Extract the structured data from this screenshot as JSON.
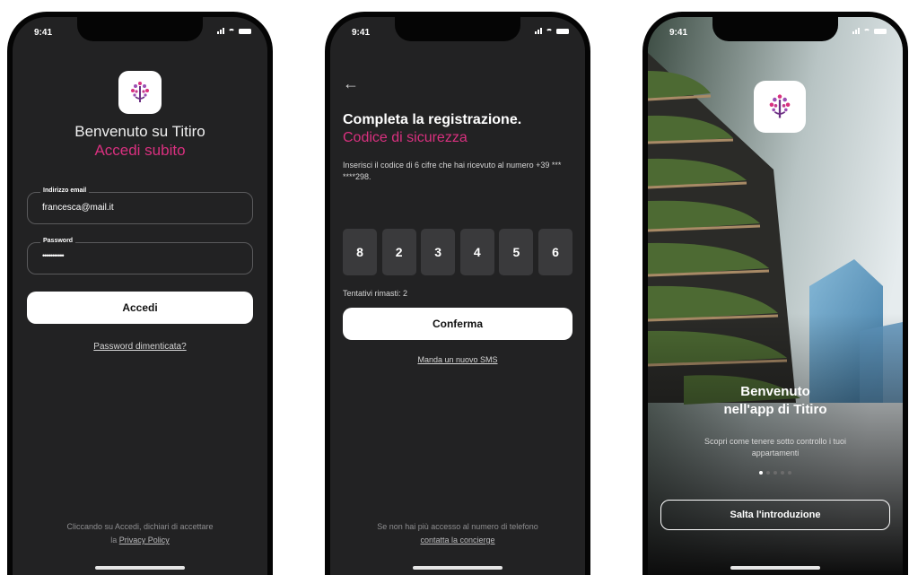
{
  "status": {
    "time": "9:41"
  },
  "login": {
    "title": "Benvenuto su Titiro",
    "subtitle": "Accedi subito",
    "email_label": "Indirizzo email",
    "email_value": "francesca@mail.it",
    "password_label": "Password",
    "password_value": "•••••••••••",
    "submit_label": "Accedi",
    "forgot_label": "Password dimenticata?",
    "footer_line1": "Cliccando su Accedi, dichiari di accettare",
    "footer_prefix": "la",
    "footer_link": "Privacy Policy"
  },
  "verify": {
    "back_glyph": "←",
    "title": "Completa la registrazione.",
    "subtitle": "Codice di sicurezza",
    "description": "Inserisci il codice di 6 cifre che hai ricevuto al numero +39 *** ****298.",
    "digits": [
      "8",
      "2",
      "3",
      "4",
      "5",
      "6"
    ],
    "attempts": "Tentativi rimasti: 2",
    "confirm_label": "Conferma",
    "resend_label": "Manda un nuovo SMS",
    "footer_line1": "Se non hai più accesso al numero di telefono",
    "footer_link": "contatta la concierge"
  },
  "intro": {
    "title_line1": "Benvenuto",
    "title_line2": "nell'app di Titiro",
    "description": "Scopri come tenere sotto controllo i tuoi appartamenti",
    "page_total": 5,
    "page_active": 1,
    "skip_label": "Salta l'introduzione"
  },
  "colors": {
    "accent": "#d9307f",
    "screen_bg": "#222223"
  },
  "icons": {
    "app": "tree-logo-icon",
    "back": "arrow-left-icon"
  }
}
